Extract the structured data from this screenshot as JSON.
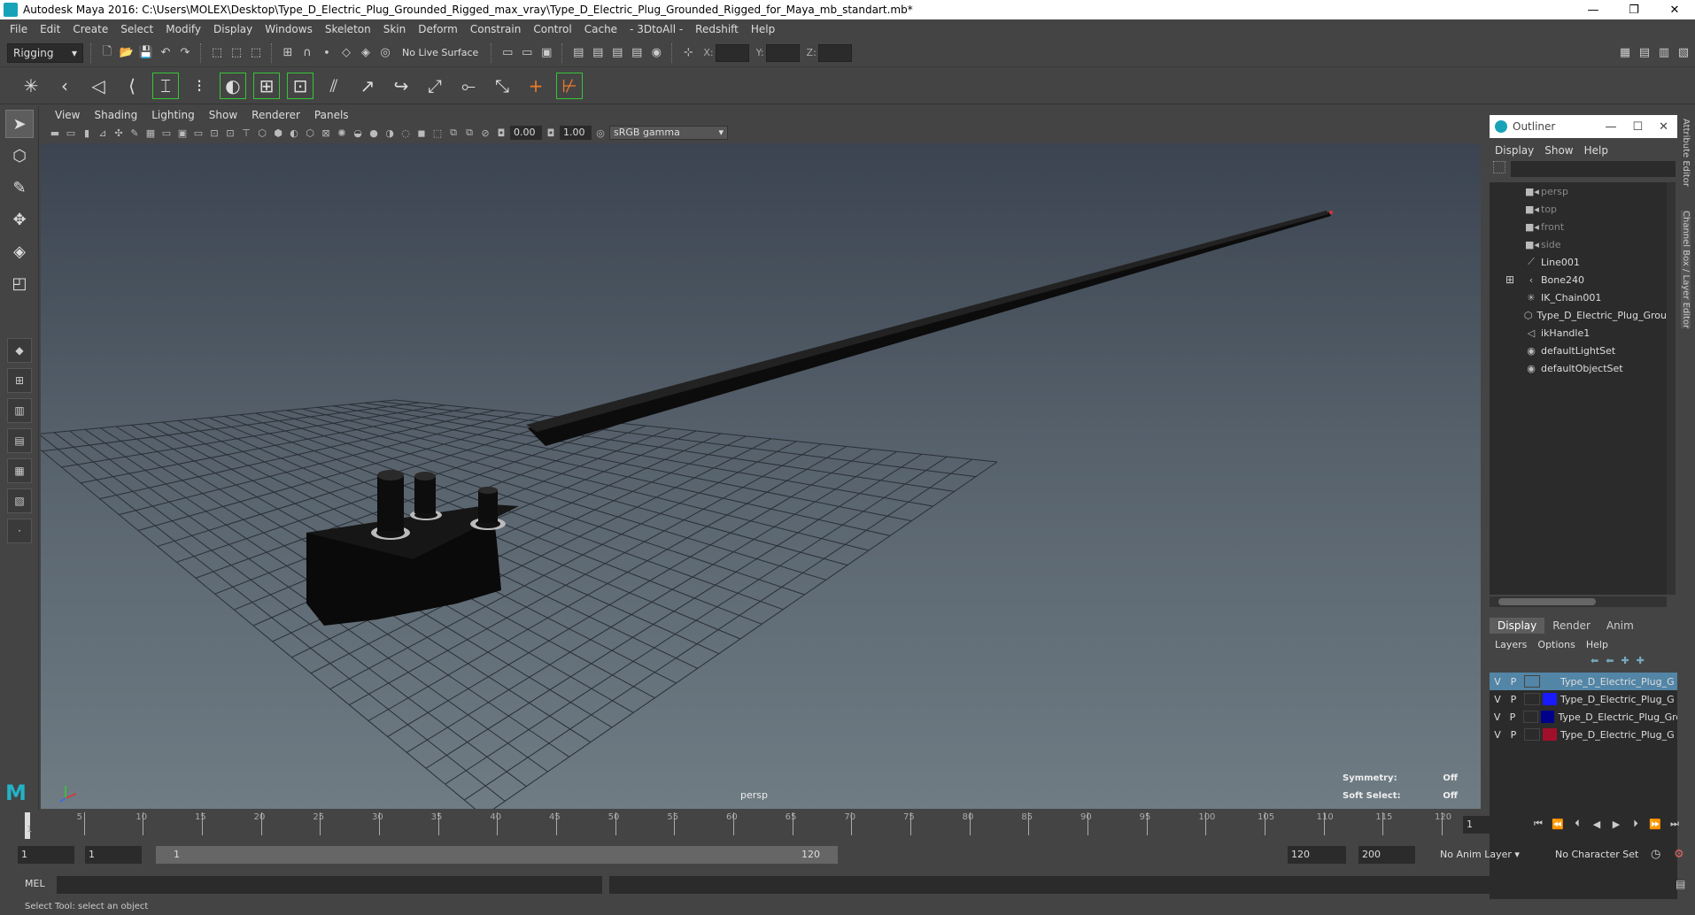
{
  "window": {
    "title": "Autodesk Maya 2016: C:\\Users\\MOLEX\\Desktop\\Type_D_Electric_Plug_Grounded_Rigged_max_vray\\Type_D_Electric_Plug_Grounded_Rigged_for_Maya_mb_standart.mb*",
    "minimize": "—",
    "restore": "❐",
    "close": "✕"
  },
  "menubar": [
    "File",
    "Edit",
    "Create",
    "Select",
    "Modify",
    "Display",
    "Windows",
    "Skeleton",
    "Skin",
    "Deform",
    "Constrain",
    "Control",
    "Cache",
    "- 3DtoAll -",
    "Redshift",
    "Help"
  ],
  "statusline": {
    "mode": "Rigging",
    "live_surface": "No Live Surface",
    "x_label": "X:",
    "y_label": "Y:",
    "z_label": "Z:"
  },
  "panel": {
    "menu": [
      "View",
      "Shading",
      "Lighting",
      "Show",
      "Renderer",
      "Panels"
    ],
    "exposure": "0.00",
    "gamma_value": "1.00",
    "color_space": "sRGB gamma",
    "camera_label": "persp",
    "symmetry_label": "Symmetry:",
    "symmetry_value": "Off",
    "soft_select_label": "Soft Select:",
    "soft_select_value": "Off"
  },
  "outliner": {
    "title": "Outliner",
    "menu": [
      "Display",
      "Show",
      "Help"
    ],
    "items": [
      {
        "label": "persp",
        "icon": "camera-icon",
        "cam": true
      },
      {
        "label": "top",
        "icon": "camera-icon",
        "cam": true
      },
      {
        "label": "front",
        "icon": "camera-icon",
        "cam": true
      },
      {
        "label": "side",
        "icon": "camera-icon",
        "cam": true
      },
      {
        "label": "Line001",
        "icon": "curve-icon",
        "cam": false
      },
      {
        "label": "Bone240",
        "icon": "joint-icon",
        "cam": false,
        "expand": true
      },
      {
        "label": "IK_Chain001",
        "icon": "ik-icon",
        "cam": false
      },
      {
        "label": "Type_D_Electric_Plug_Grou",
        "icon": "mesh-icon",
        "cam": false
      },
      {
        "label": "ikHandle1",
        "icon": "ikhandle-icon",
        "cam": false
      },
      {
        "label": "defaultLightSet",
        "icon": "set-icon",
        "cam": false
      },
      {
        "label": "defaultObjectSet",
        "icon": "set-icon",
        "cam": false
      }
    ]
  },
  "layer_editor": {
    "tabs": [
      "Display",
      "Render",
      "Anim"
    ],
    "menu": [
      "Layers",
      "Options",
      "Help"
    ],
    "layers": [
      {
        "v": "V",
        "p": "P",
        "name": "Type_D_Electric_Plug_G",
        "color": "#5285a6",
        "selected": true
      },
      {
        "v": "V",
        "p": "P",
        "name": "Type_D_Electric_Plug_G",
        "color": "#1a1aff",
        "selected": false
      },
      {
        "v": "V",
        "p": "P",
        "name": "Type_D_Electric_Plug_Gro",
        "color": "#00008b",
        "selected": false
      },
      {
        "v": "V",
        "p": "P",
        "name": "Type_D_Electric_Plug_G",
        "color": "#a0102a",
        "selected": false
      }
    ]
  },
  "side_tabs": {
    "attribute_editor": "Attribute Editor",
    "channel_box": "Channel Box / Layer Editor"
  },
  "timeline": {
    "ticks": [
      5,
      10,
      15,
      20,
      25,
      30,
      35,
      40,
      45,
      50,
      55,
      60,
      65,
      70,
      75,
      80,
      85,
      90,
      95,
      100,
      105,
      110,
      115,
      120
    ],
    "start_tick": "1",
    "current_frame": "1"
  },
  "range": {
    "start": "1",
    "anim_start": "1",
    "range_start": "1",
    "range_end": "120",
    "playback_end": "120",
    "anim_end": "200",
    "anim_layer": "No Anim Layer",
    "char_set": "No Character Set"
  },
  "command": {
    "mel_label": "MEL",
    "help_text": "Select Tool: select an object"
  }
}
